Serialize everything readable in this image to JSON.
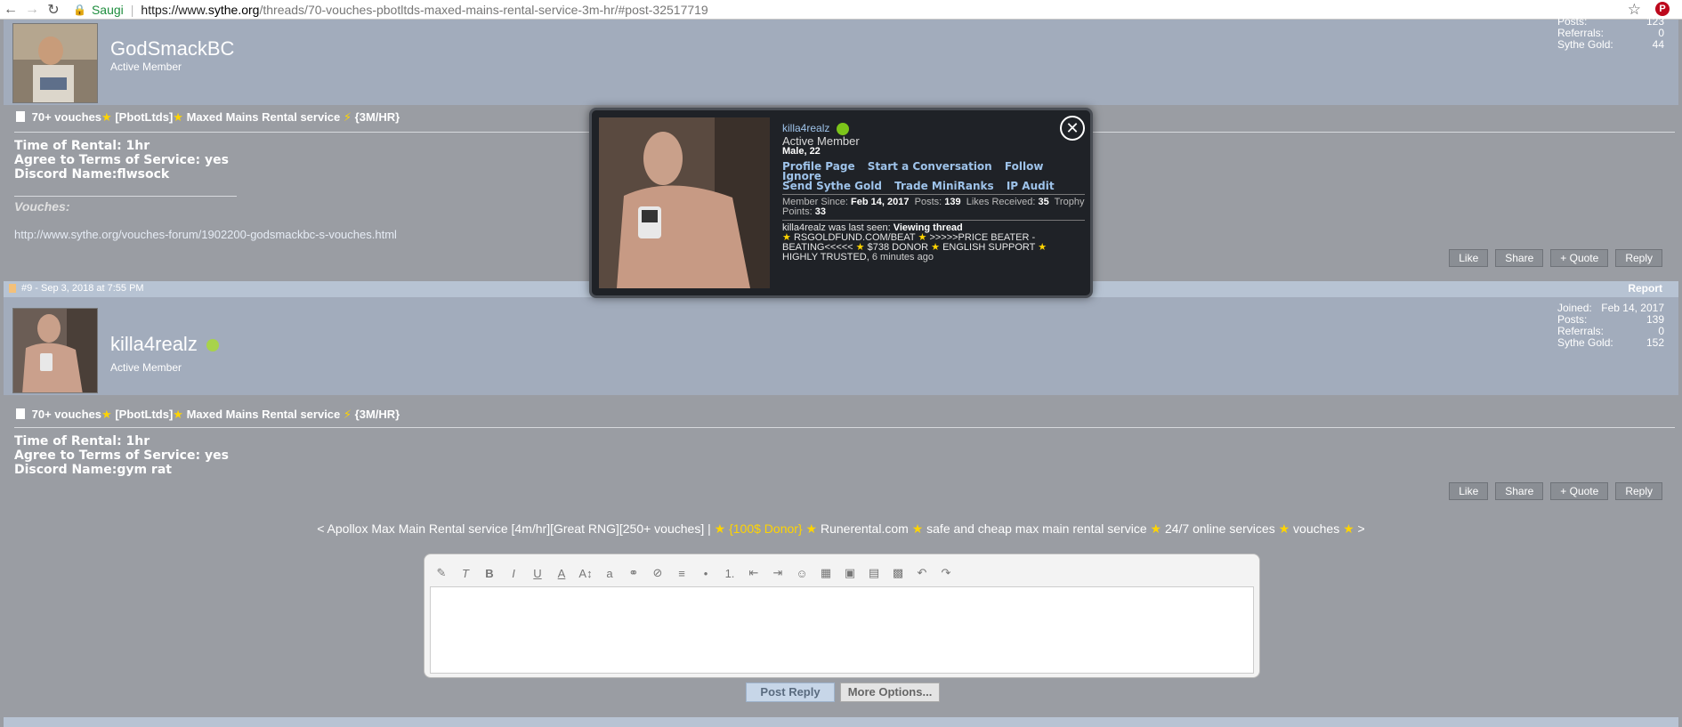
{
  "browser": {
    "secure_label": "Saugi",
    "url_scheme": "https://www.",
    "url_domain": "sythe.org",
    "url_path": "/threads/70-vouches-pbotltds-maxed-mains-rental-service-3m-hr/#post-32517719"
  },
  "post1": {
    "username": "GodSmackBC",
    "usertitle": "Active Member",
    "stats": {
      "posts_label": "Posts:",
      "posts": "123",
      "referrals_label": "Referrals:",
      "referrals": "0",
      "gold_label": "Sythe Gold:",
      "gold": "44"
    },
    "thread_title_a": "70+ vouches",
    "thread_title_b": "[PbotLtds]",
    "thread_title_c": "Maxed Mains Rental service",
    "thread_title_d": "{3M/HR}",
    "lines": [
      "Time of Rental: 1hr",
      "Agree to Terms of Service: yes",
      "Discord Name:flwsock"
    ],
    "vouches_label": "Vouches:",
    "vouches_link": "http://www.sythe.org/vouches-forum/1902200-godsmackbc-s-vouches.html",
    "buttons": [
      "Like",
      "Share",
      "+ Quote",
      "Reply"
    ]
  },
  "postbar2": {
    "number": "#9 - Sep 3, 2018 at 7:55 PM",
    "report": "Report"
  },
  "post2": {
    "username": "killa4realz",
    "usertitle": "Active Member",
    "stats": {
      "joined_label": "Joined:",
      "joined": "Feb 14, 2017",
      "posts_label": "Posts:",
      "posts": "139",
      "referrals_label": "Referrals:",
      "referrals": "0",
      "gold_label": "Sythe Gold:",
      "gold": "152"
    },
    "thread_title_a": "70+ vouches",
    "thread_title_b": "[PbotLtds]",
    "thread_title_c": "Maxed Mains Rental service",
    "thread_title_d": "{3M/HR}",
    "lines": [
      "Time of Rental: 1hr",
      "Agree to Terms of Service: yes",
      "Discord Name:gym rat"
    ],
    "buttons": [
      "Like",
      "Share",
      "+ Quote",
      "Reply"
    ]
  },
  "signature": {
    "a": "< Apollox Max Main Rental service [4m/hr][Great RNG][250+ vouches] |",
    "b": "{100$ Donor}",
    "c": "Runerental.com",
    "d": "safe and cheap max main rental service",
    "e": "24/7 online services",
    "f": "vouches",
    "g": ">"
  },
  "editor": {
    "post_reply": "Post Reply",
    "more_options": "More Options..."
  },
  "popup": {
    "name": "killa4realz",
    "title": "Active Member",
    "gender_age": "Male, 22",
    "links_row1": [
      "Profile Page",
      "Start a Conversation",
      "Follow",
      "Ignore"
    ],
    "links_row2": [
      "Send Sythe Gold",
      "Trade MiniRanks",
      "IP Audit"
    ],
    "member_since_label": "Member Since:",
    "member_since": "Feb 14, 2017",
    "posts_label": "Posts:",
    "posts": "139",
    "likes_label": "Likes Received:",
    "likes": "35",
    "trophy_label": "Trophy Points:",
    "trophy": "33",
    "seen_prefix": "killa4realz was last seen:",
    "seen_action": "Viewing thread",
    "seen_thread_a": "RSGOLDFUND.COM/BEAT",
    "seen_thread_b": ">>>>>PRICE BEATER - BEATING<<<<<",
    "seen_thread_c": "$738 DONOR",
    "seen_thread_d": "ENGLISH SUPPORT",
    "seen_thread_e": "HIGHLY TRUSTED,",
    "seen_ago": "6 minutes ago"
  }
}
